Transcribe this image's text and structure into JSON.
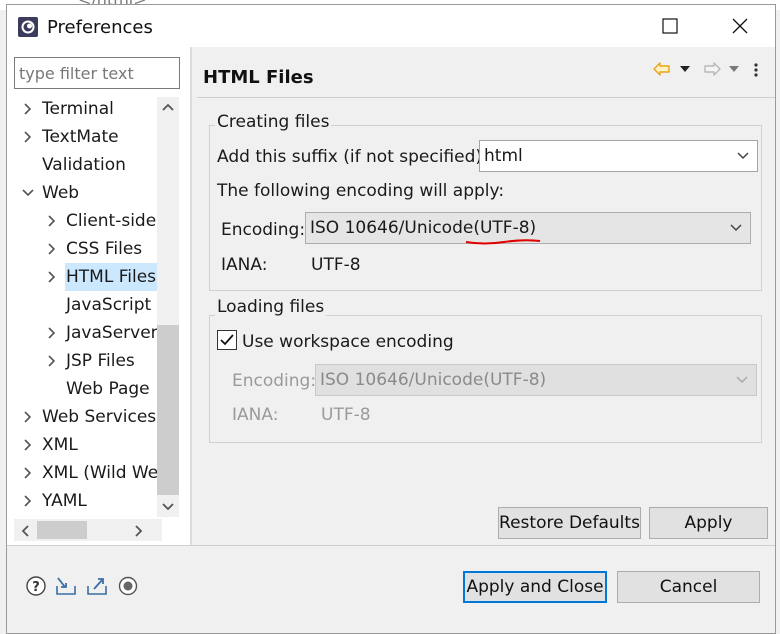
{
  "background": {
    "code_snippet": "</html>"
  },
  "window": {
    "title": "Preferences"
  },
  "filter": {
    "placeholder": "type filter text"
  },
  "tree": {
    "items": [
      {
        "label": "Terminal",
        "indent": 0,
        "expander": "collapsed"
      },
      {
        "label": "TextMate",
        "indent": 0,
        "expander": "collapsed"
      },
      {
        "label": "Validation",
        "indent": 0,
        "expander": "none"
      },
      {
        "label": "Web",
        "indent": 0,
        "expander": "expanded"
      },
      {
        "label": "Client-side",
        "indent": 1,
        "expander": "collapsed"
      },
      {
        "label": "CSS Files",
        "indent": 1,
        "expander": "collapsed"
      },
      {
        "label": "HTML Files",
        "indent": 1,
        "expander": "collapsed",
        "selected": true
      },
      {
        "label": "JavaScript",
        "indent": 1,
        "expander": "none"
      },
      {
        "label": "JavaServer",
        "indent": 1,
        "expander": "collapsed"
      },
      {
        "label": "JSP Files",
        "indent": 1,
        "expander": "collapsed"
      },
      {
        "label": "Web Page",
        "indent": 1,
        "expander": "none"
      },
      {
        "label": "Web Services",
        "indent": 0,
        "expander": "collapsed"
      },
      {
        "label": "XML",
        "indent": 0,
        "expander": "collapsed"
      },
      {
        "label": "XML (Wild Web",
        "indent": 0,
        "expander": "collapsed"
      },
      {
        "label": "YAML",
        "indent": 0,
        "expander": "collapsed"
      }
    ]
  },
  "page": {
    "title": "HTML Files",
    "creating": {
      "group_label": "Creating files",
      "suffix_label": "Add this suffix (if not specified):",
      "suffix_value": "html",
      "encoding_info": "The following encoding will apply:",
      "encoding_label": "Encoding:",
      "encoding_value": "ISO 10646/Unicode(UTF-8)",
      "iana_label": "IANA:",
      "iana_value": "UTF-8"
    },
    "loading": {
      "group_label": "Loading files",
      "workspace_checkbox_label": "Use workspace encoding",
      "workspace_checked": true,
      "encoding_label": "Encoding:",
      "encoding_value": "ISO 10646/Unicode(UTF-8)",
      "iana_label": "IANA:",
      "iana_value": "UTF-8"
    },
    "restore_defaults_label": "Restore Defaults",
    "apply_label": "Apply"
  },
  "footer": {
    "apply_close_label": "Apply and Close",
    "cancel_label": "Cancel"
  },
  "icons": {
    "help": "help-icon",
    "import": "import-icon",
    "export": "export-icon",
    "record": "oomph-record-icon",
    "back": "back-arrow-icon",
    "forward": "forward-arrow-icon"
  },
  "colors": {
    "selection": "#cce8ff",
    "default_button_border": "#0078d7",
    "annotation_underline": "#e00000",
    "back_arrow": "#e8a317"
  }
}
